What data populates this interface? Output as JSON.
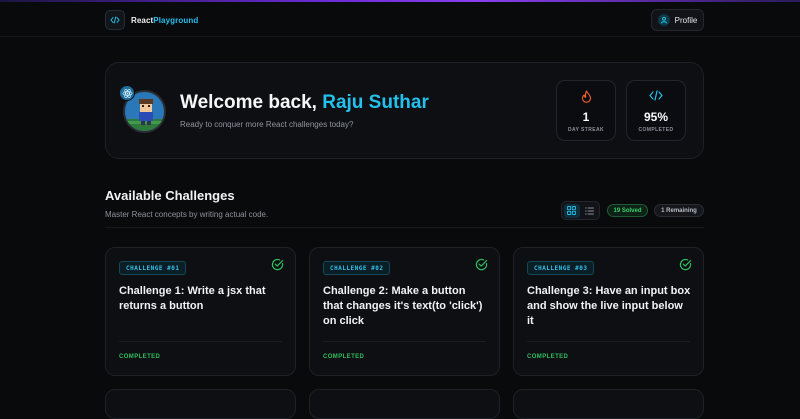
{
  "header": {
    "logo_text_a": "React",
    "logo_text_b": "Playground",
    "profile_label": "Profile"
  },
  "welcome": {
    "greeting": "Welcome back, ",
    "name": "Raju Suthar",
    "subtitle": "Ready to conquer more React challenges today?",
    "stats": [
      {
        "value": "1",
        "label": "DAY STREAK",
        "icon": "flame-icon"
      },
      {
        "value": "95%",
        "label": "COMPLETED",
        "icon": "code-icon"
      }
    ]
  },
  "challenges": {
    "title": "Available Challenges",
    "subtitle": "Master React concepts by writing actual code.",
    "solved_badge": "19 Solved",
    "remaining_badge": "1 Remaining",
    "items": [
      {
        "tag": "CHALLENGE #01",
        "title": "Challenge 1: Write a jsx that returns a button",
        "status": "COMPLETED"
      },
      {
        "tag": "CHALLENGE #02",
        "title": "Challenge 2: Make a button that changes it's text(to 'click') on click",
        "status": "COMPLETED"
      },
      {
        "tag": "CHALLENGE #03",
        "title": "Challenge 3: Have an input box and show the live input below it",
        "status": "COMPLETED"
      }
    ]
  },
  "colors": {
    "accent": "#22c1ee",
    "success": "#2fbf5f",
    "streak": "#f2622e",
    "background": "#090a0c"
  }
}
